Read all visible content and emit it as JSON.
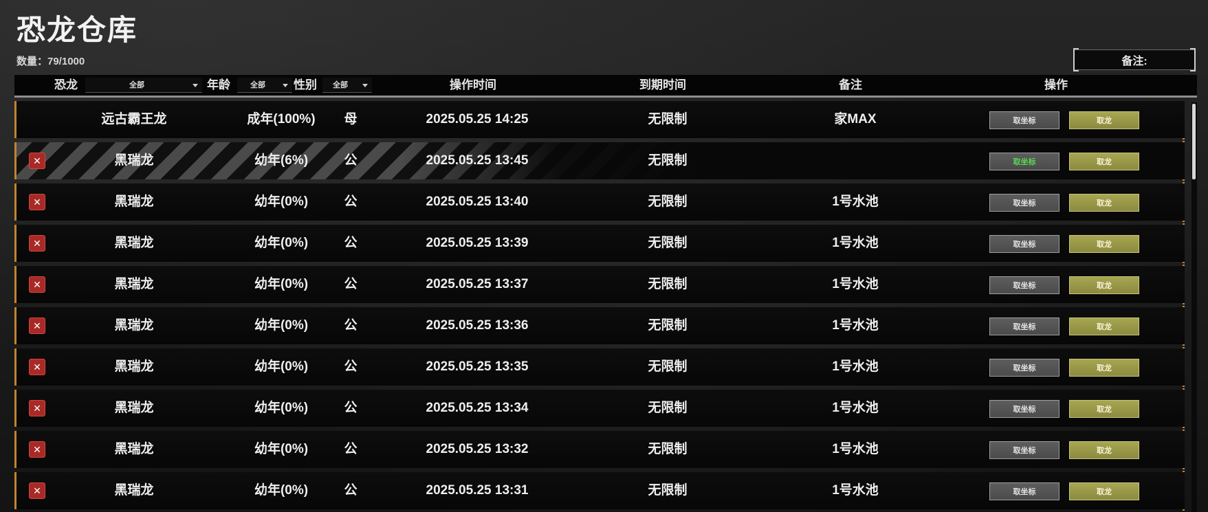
{
  "header": {
    "title": "恐龙仓库",
    "count_label": "数量：79/1000",
    "note_label": "备注:"
  },
  "columns": {
    "dino": "恐龙",
    "age": "年龄",
    "gender": "性别",
    "op_time": "操作时间",
    "expire": "到期时间",
    "note": "备注",
    "action": "操作"
  },
  "filters": {
    "dino": "全部",
    "age": "全部",
    "gender": "全部"
  },
  "buttons": {
    "coord": "取坐标",
    "take": "取龙"
  },
  "rows": [
    {
      "name": "远古霸王龙",
      "age": "成年(100%)",
      "gender": "母",
      "time": "2025.05.25 14:25",
      "expire": "无限制",
      "note": "家MAX",
      "deletable": false,
      "selected": false
    },
    {
      "name": "黑瑞龙",
      "age": "幼年(6%)",
      "gender": "公",
      "time": "2025.05.25 13:45",
      "expire": "无限制",
      "note": "",
      "deletable": true,
      "selected": true
    },
    {
      "name": "黑瑞龙",
      "age": "幼年(0%)",
      "gender": "公",
      "time": "2025.05.25 13:40",
      "expire": "无限制",
      "note": "1号水池",
      "deletable": true,
      "selected": false
    },
    {
      "name": "黑瑞龙",
      "age": "幼年(0%)",
      "gender": "公",
      "time": "2025.05.25 13:39",
      "expire": "无限制",
      "note": "1号水池",
      "deletable": true,
      "selected": false
    },
    {
      "name": "黑瑞龙",
      "age": "幼年(0%)",
      "gender": "公",
      "time": "2025.05.25 13:37",
      "expire": "无限制",
      "note": "1号水池",
      "deletable": true,
      "selected": false
    },
    {
      "name": "黑瑞龙",
      "age": "幼年(0%)",
      "gender": "公",
      "time": "2025.05.25 13:36",
      "expire": "无限制",
      "note": "1号水池",
      "deletable": true,
      "selected": false
    },
    {
      "name": "黑瑞龙",
      "age": "幼年(0%)",
      "gender": "公",
      "time": "2025.05.25 13:35",
      "expire": "无限制",
      "note": "1号水池",
      "deletable": true,
      "selected": false
    },
    {
      "name": "黑瑞龙",
      "age": "幼年(0%)",
      "gender": "公",
      "time": "2025.05.25 13:34",
      "expire": "无限制",
      "note": "1号水池",
      "deletable": true,
      "selected": false
    },
    {
      "name": "黑瑞龙",
      "age": "幼年(0%)",
      "gender": "公",
      "time": "2025.05.25 13:32",
      "expire": "无限制",
      "note": "1号水池",
      "deletable": true,
      "selected": false
    },
    {
      "name": "黑瑞龙",
      "age": "幼年(0%)",
      "gender": "公",
      "time": "2025.05.25 13:31",
      "expire": "无限制",
      "note": "1号水池",
      "deletable": true,
      "selected": false
    }
  ],
  "icons": {
    "delete": "close-icon",
    "dropdown": "chevron-down-icon"
  },
  "colors": {
    "row_accent": "#c2842e",
    "delete_red": "#a82a26",
    "take_button": "#a7a651",
    "coord_active_text": "#58d656"
  }
}
